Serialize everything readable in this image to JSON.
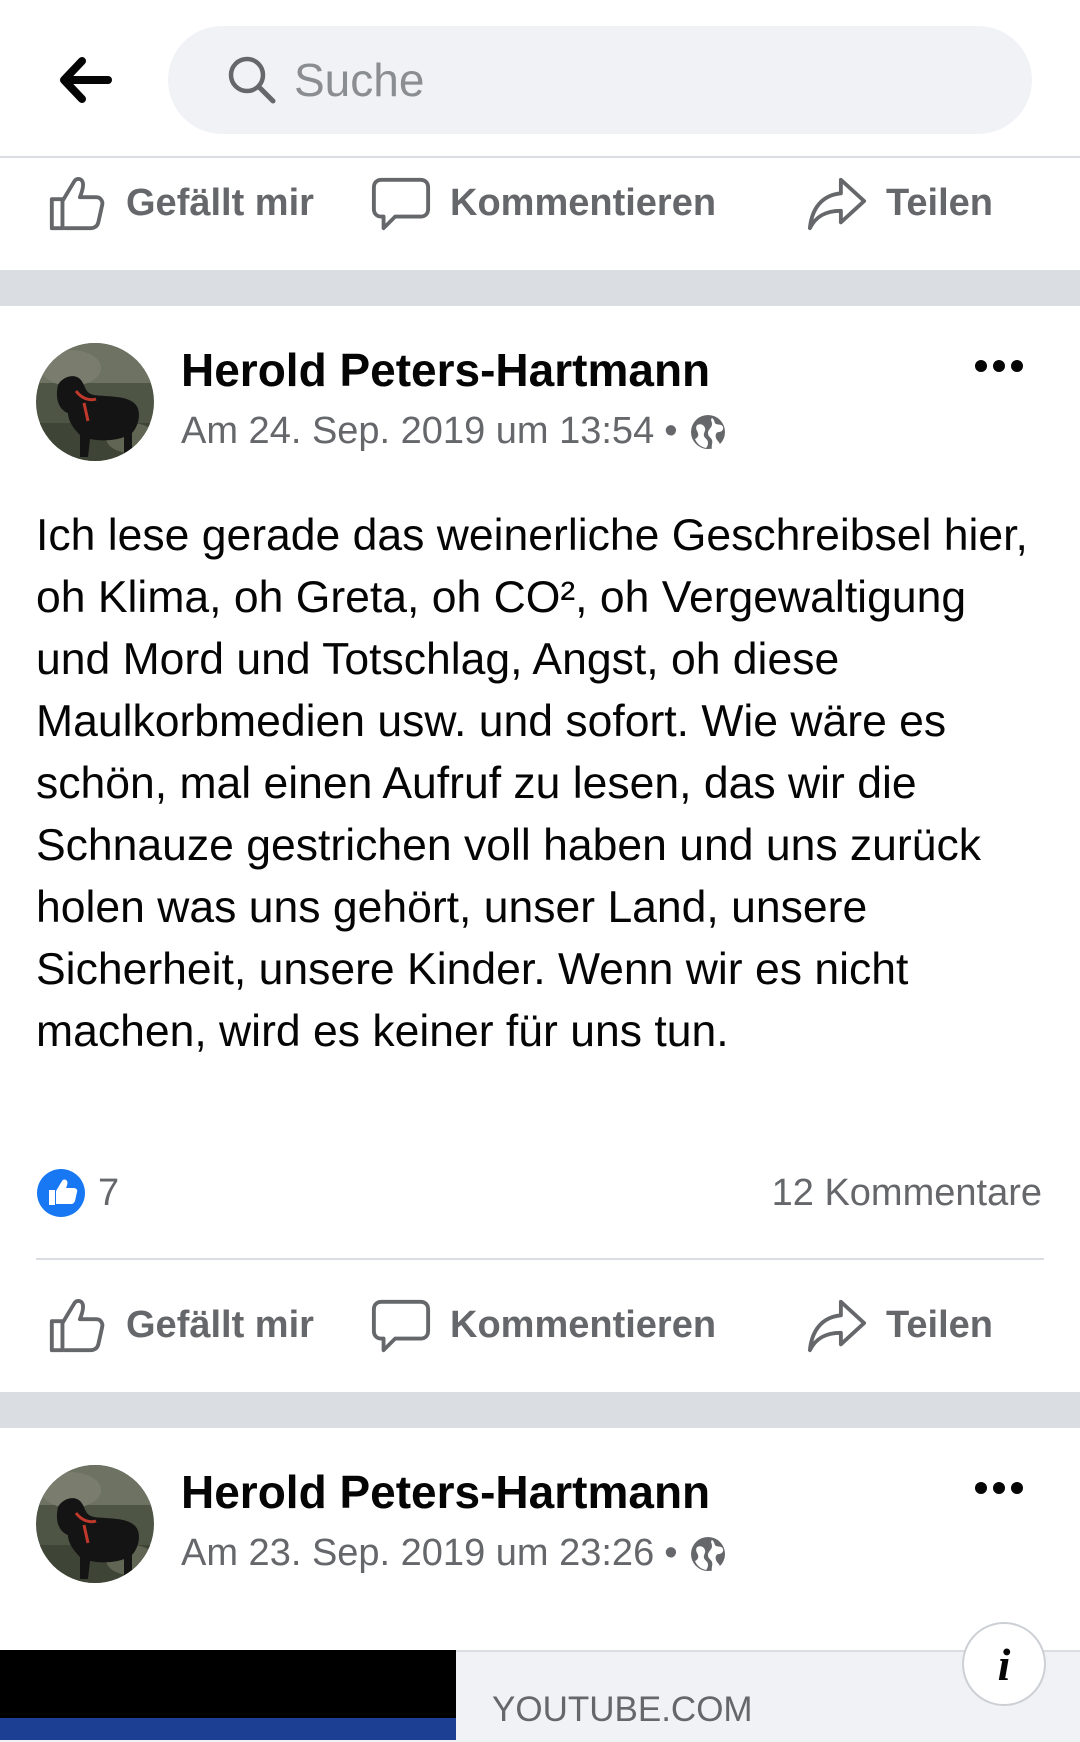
{
  "search": {
    "placeholder": "Suche"
  },
  "actions": {
    "like": "Gefällt mir",
    "comment": "Kommentieren",
    "share": "Teilen"
  },
  "posts": [
    {
      "author": "Herold Peters-Hartmann",
      "timestamp": "Am 24. Sep. 2019 um 13:54",
      "separator": "•",
      "privacy_icon": "globe-icon",
      "text": "Ich lese gerade das weinerliche Geschreibsel hier, oh Klima, oh Greta, oh CO², oh Vergewaltigung und Mord und Totschlag, Angst, oh diese Maulkorbmedien usw. und sofort. Wie wäre es schön, mal einen Aufruf zu lesen, das wir die Schnauze gestrichen voll haben und uns zurück holen was uns gehört, unser Land, unsere Sicherheit, unsere Kinder. Wenn wir es nicht machen, wird es keiner für uns tun.",
      "reactions_count": "7",
      "comments_count": "12 Kommentare"
    },
    {
      "author": "Herold Peters-Hartmann",
      "timestamp": "Am 23. Sep. 2019 um 23:26",
      "separator": "•",
      "privacy_icon": "globe-icon",
      "link_preview": {
        "domain": "YOUTUBE.COM",
        "info_label": "i"
      }
    }
  ],
  "colors": {
    "like_blue": "#1877f2",
    "secondary_text": "#65676b",
    "separator": "#dadde1",
    "search_bg": "#f0f2f5"
  }
}
